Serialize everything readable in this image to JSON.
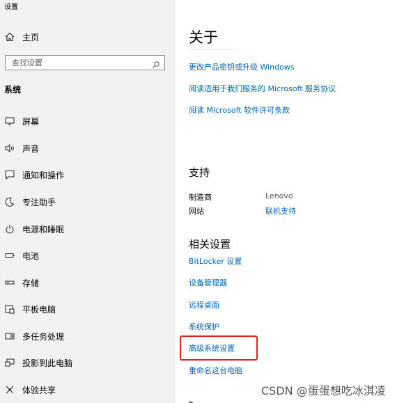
{
  "window": {
    "title": "设置"
  },
  "sidebar": {
    "home_label": "主页",
    "search_placeholder": "查找设置",
    "section_heading": "系统",
    "items": [
      {
        "label": "屏幕",
        "icon": "monitor-icon"
      },
      {
        "label": "声音",
        "icon": "speaker-icon"
      },
      {
        "label": "通知和操作",
        "icon": "notification-icon"
      },
      {
        "label": "专注助手",
        "icon": "moon-icon"
      },
      {
        "label": "电源和睡眠",
        "icon": "power-icon"
      },
      {
        "label": "电池",
        "icon": "battery-icon"
      },
      {
        "label": "存储",
        "icon": "storage-icon"
      },
      {
        "label": "平板电脑",
        "icon": "tablet-icon"
      },
      {
        "label": "多任务处理",
        "icon": "multitask-icon"
      },
      {
        "label": "投影到此电脑",
        "icon": "projection-icon"
      },
      {
        "label": "体验共享",
        "icon": "shared-experience-icon"
      }
    ]
  },
  "main": {
    "title": "关于",
    "top_links": [
      "更改产品密钥或升级 Windows",
      "阅读适用于我们服务的 Microsoft 服务协议",
      "阅读 Microsoft 软件许可条款"
    ],
    "support": {
      "heading": "支持",
      "manufacturer_label": "制造商",
      "manufacturer_value": "Lenovo",
      "website_label": "网站",
      "website_value": "联机支持"
    },
    "related": {
      "heading": "相关设置",
      "links": [
        "BitLocker 设置",
        "设备管理器",
        "远程桌面",
        "系统保护",
        "高级系统设置",
        "重命名这台电脑"
      ]
    },
    "cut_heading": "?"
  },
  "annotation": {
    "highlight_color": "#e8201c",
    "highlighted_item": "高级系统设置"
  },
  "watermark": "CSDN @蛋蛋想吃冰淇凌",
  "colors": {
    "sidebar_bg": "#f2f2f2",
    "link": "#0067b8",
    "content_bg": "#ffffff"
  }
}
